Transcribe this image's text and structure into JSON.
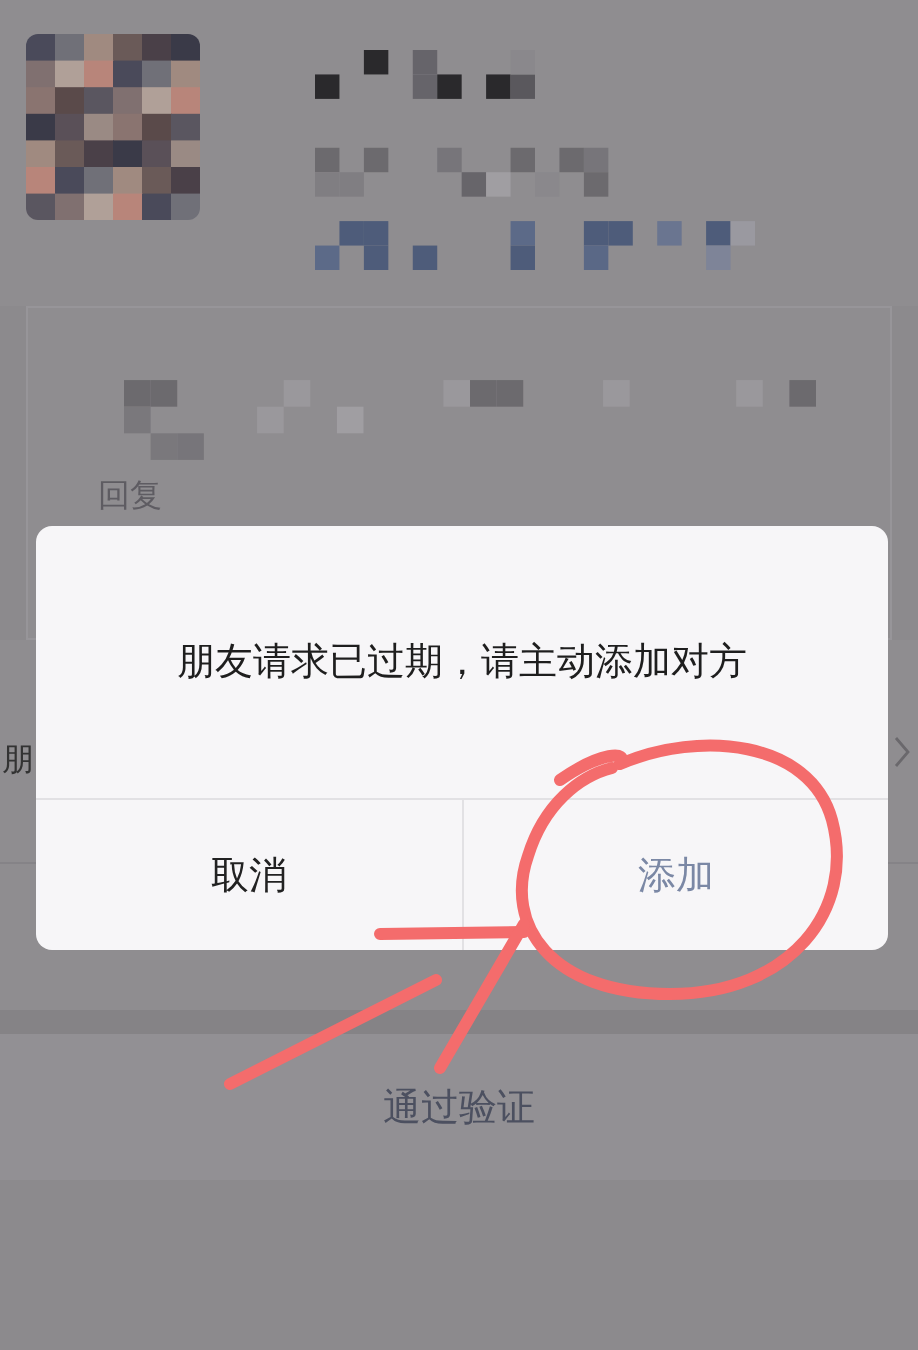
{
  "message_card": {
    "reply_link": "回复"
  },
  "rows": [
    {
      "label": "朋",
      "chevron": true
    }
  ],
  "primary_action": "通过验证",
  "dialog": {
    "message": "朋友请求已过期，请主动添加对方",
    "buttons": [
      {
        "label": "取消",
        "kind": "cancel"
      },
      {
        "label": "添加",
        "kind": "confirm"
      }
    ]
  }
}
